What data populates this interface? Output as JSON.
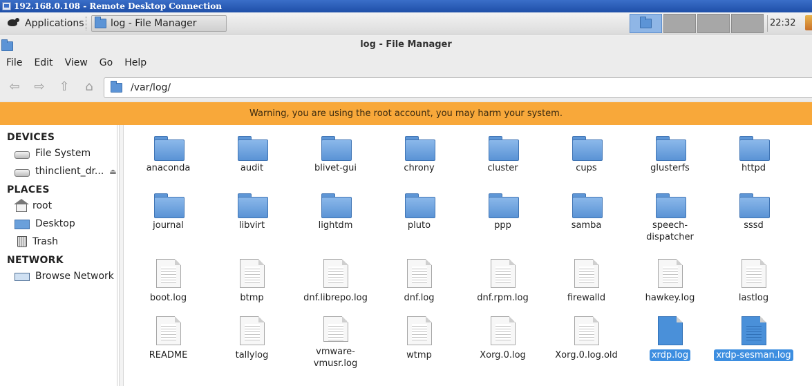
{
  "rdp": {
    "title": "192.168.0.108 - Remote Desktop Connection"
  },
  "panel": {
    "applications_label": "Applications",
    "task_label": "log - File Manager",
    "clock": "22:32"
  },
  "window": {
    "title": "log - File Manager"
  },
  "menu": {
    "file": "File",
    "edit": "Edit",
    "view": "View",
    "go": "Go",
    "help": "Help"
  },
  "toolbar": {
    "path": "/var/log/"
  },
  "warning": {
    "text": "Warning, you are using the root account, you may harm your system."
  },
  "sidebar": {
    "devices_heading": "DEVICES",
    "devices": [
      "File System",
      "thinclient_dr..."
    ],
    "places_heading": "PLACES",
    "places": [
      "root",
      "Desktop",
      "Trash"
    ],
    "network_heading": "NETWORK",
    "network": [
      "Browse Network"
    ]
  },
  "files": [
    {
      "name": "anaconda",
      "type": "folder"
    },
    {
      "name": "audit",
      "type": "folder"
    },
    {
      "name": "blivet-gui",
      "type": "folder"
    },
    {
      "name": "chrony",
      "type": "folder"
    },
    {
      "name": "cluster",
      "type": "folder"
    },
    {
      "name": "cups",
      "type": "folder"
    },
    {
      "name": "glusterfs",
      "type": "folder"
    },
    {
      "name": "httpd",
      "type": "folder"
    },
    {
      "name": "journal",
      "type": "folder"
    },
    {
      "name": "libvirt",
      "type": "folder"
    },
    {
      "name": "lightdm",
      "type": "folder"
    },
    {
      "name": "pluto",
      "type": "folder"
    },
    {
      "name": "ppp",
      "type": "folder"
    },
    {
      "name": "samba",
      "type": "folder"
    },
    {
      "name": "speech-dispatcher",
      "type": "folder"
    },
    {
      "name": "sssd",
      "type": "folder"
    },
    {
      "name": "boot.log",
      "type": "file"
    },
    {
      "name": "btmp",
      "type": "file"
    },
    {
      "name": "dnf.librepo.log",
      "type": "file"
    },
    {
      "name": "dnf.log",
      "type": "file"
    },
    {
      "name": "dnf.rpm.log",
      "type": "file"
    },
    {
      "name": "firewalld",
      "type": "file"
    },
    {
      "name": "hawkey.log",
      "type": "file"
    },
    {
      "name": "lastlog",
      "type": "file"
    },
    {
      "name": "README",
      "type": "file"
    },
    {
      "name": "tallylog",
      "type": "file"
    },
    {
      "name": "vmware-vmusr.log",
      "type": "file"
    },
    {
      "name": "wtmp",
      "type": "file"
    },
    {
      "name": "Xorg.0.log",
      "type": "file"
    },
    {
      "name": "Xorg.0.log.old",
      "type": "file"
    },
    {
      "name": "xrdp.log",
      "type": "file",
      "selected": true
    },
    {
      "name": "xrdp-sesman.log",
      "type": "file",
      "selected": true
    }
  ],
  "colors": {
    "warning": "#f8a83a",
    "selection": "#3d8ee0",
    "folder": "#5a93d5"
  }
}
